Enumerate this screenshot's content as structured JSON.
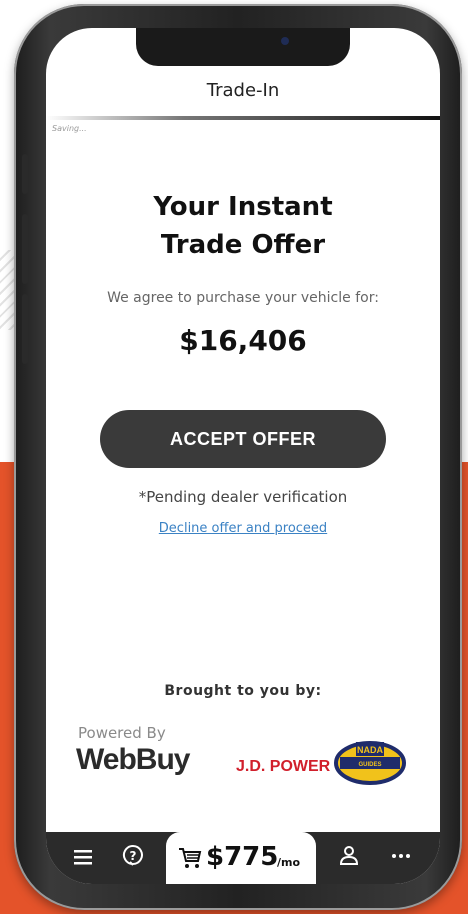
{
  "header": {
    "title": "Trade-In",
    "status": "Saving..."
  },
  "offer": {
    "title_line1": "Your Instant",
    "title_line2": "Trade Offer",
    "subtitle": "We agree to purchase your vehicle for:",
    "price": "$16,406",
    "accept_label": "ACCEPT OFFER",
    "pending_note": "*Pending dealer verification",
    "decline_link": "Decline offer and proceed"
  },
  "sponsors": {
    "brought_label": "Brought to you by:",
    "powered_by": "Powered By",
    "webbuy_logo": "WebBuy",
    "jdpower_logo": "J.D. POWER",
    "nada_logo": "NADA GUIDES"
  },
  "bottom_nav": {
    "menu_icon": "menu-icon",
    "help_icon": "help-icon",
    "cart_icon": "cart-icon",
    "payment": "$775",
    "payment_unit": "/mo",
    "profile_icon": "user-icon",
    "more_icon": "more-icon"
  },
  "colors": {
    "accent_orange": "#e4532a",
    "button_dark": "#3a3a3a",
    "link_blue": "#3b82c4",
    "jdpower_red": "#d11f2b"
  }
}
